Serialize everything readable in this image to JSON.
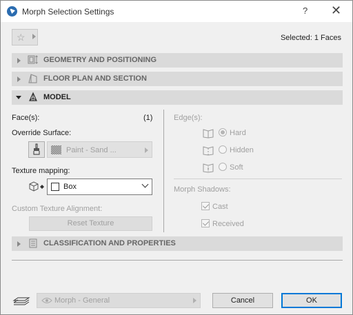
{
  "window": {
    "title": "Morph Selection Settings",
    "help": "?",
    "close": "✕"
  },
  "toolbar": {
    "favorites_icon": "star-icon",
    "selected_text": "Selected: 1 Faces"
  },
  "panels": [
    {
      "label": "GEOMETRY AND POSITIONING",
      "expanded": false,
      "icon": "geometry-icon"
    },
    {
      "label": "FLOOR PLAN AND SECTION",
      "expanded": false,
      "icon": "floorplan-icon"
    },
    {
      "label": "MODEL",
      "expanded": true,
      "icon": "model-icon"
    },
    {
      "label": "CLASSIFICATION AND PROPERTIES",
      "expanded": false,
      "icon": "classification-icon"
    }
  ],
  "model": {
    "faces_label": "Face(s):",
    "faces_count": "(1)",
    "override_label": "Override Surface:",
    "paint_value": "Paint - Sand ...",
    "texture_label": "Texture mapping:",
    "texture_value": "Box",
    "custom_align_label": "Custom Texture Alignment:",
    "reset_label": "Reset Texture",
    "edges_label": "Edge(s):",
    "edge_options": [
      {
        "label": "Hard",
        "checked": true
      },
      {
        "label": "Hidden",
        "checked": false
      },
      {
        "label": "Soft",
        "checked": false
      }
    ],
    "shadows_label": "Morph Shadows:",
    "shadow_options": [
      {
        "label": "Cast",
        "checked": true
      },
      {
        "label": "Received",
        "checked": true
      }
    ]
  },
  "footer": {
    "favorite_value": "Morph - General",
    "cancel_label": "Cancel",
    "ok_label": "OK"
  },
  "colors": {
    "accent": "#0078d7",
    "panel_bg": "#dadada",
    "dialog_bg": "#f0f0f0"
  }
}
